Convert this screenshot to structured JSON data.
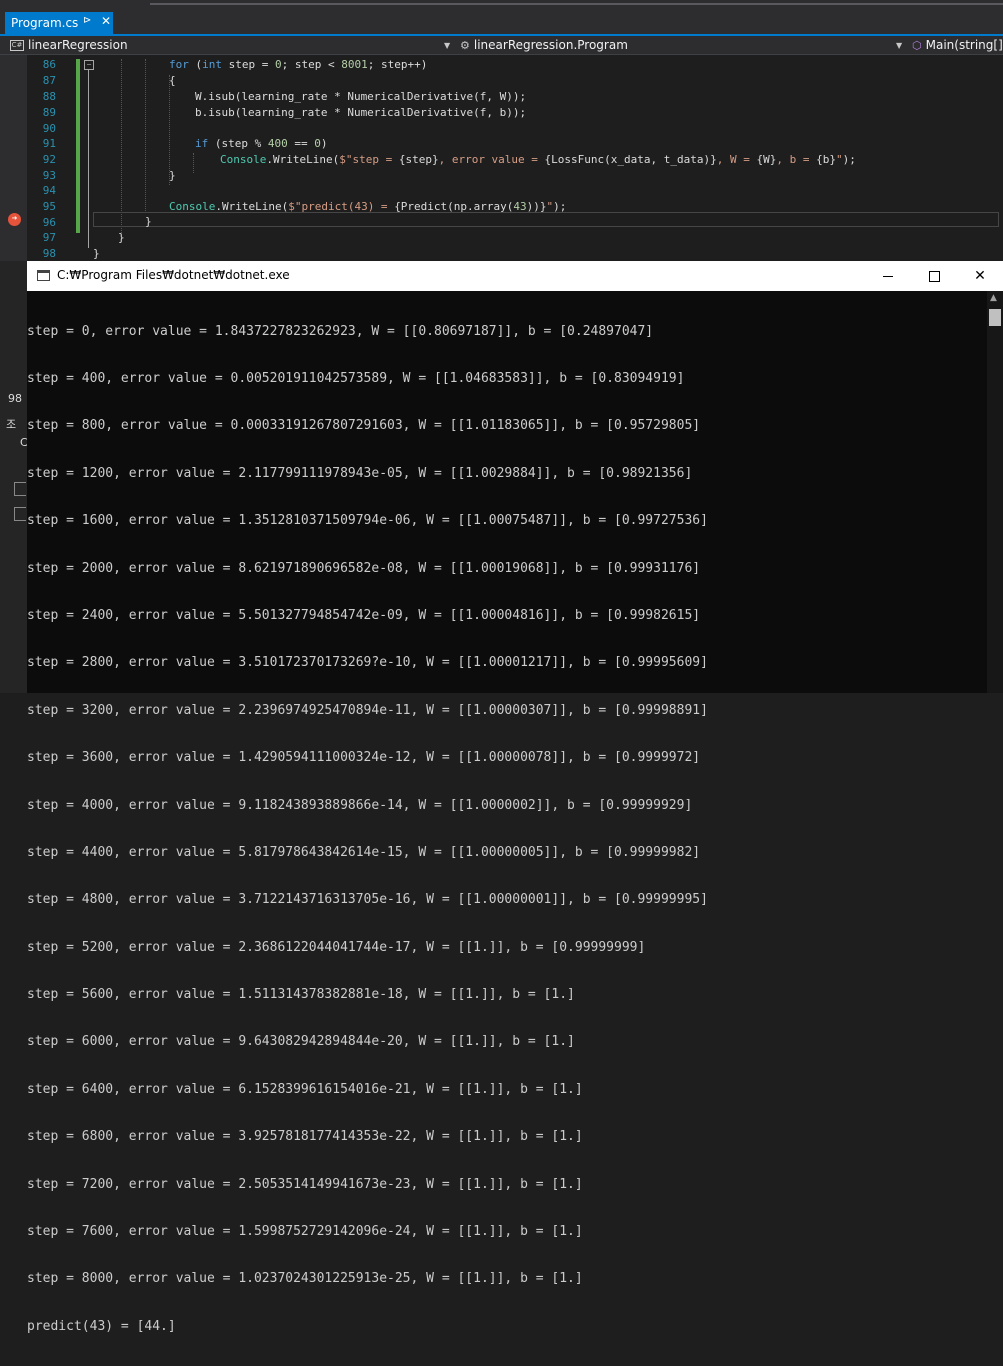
{
  "tab": {
    "title": "Program.cs",
    "pin": "⊳",
    "close": "✕"
  },
  "nav": {
    "project": "linearRegression",
    "class": "linearRegression.Program",
    "member": "Main(string[]"
  },
  "editor": {
    "line_numbers": [
      "86",
      "87",
      "88",
      "89",
      "90",
      "91",
      "92",
      "93",
      "94",
      "95",
      "96",
      "97",
      "98"
    ]
  },
  "side_panel": {
    "labels": [
      "98",
      "조",
      "C"
    ]
  },
  "console": {
    "title": "C:₩Program Files₩dotnet₩dotnet.exe",
    "lines": [
      "step = 0, error value = 1.8437227823262923, W = [[0.80697187]], b = [0.24897047]",
      "step = 400, error value = 0.005201911042573589, W = [[1.04683583]], b = [0.83094919]",
      "step = 800, error value = 0.0003319126780729160З, W = [[1.01183065]], b = [0.95729805]",
      "step = 1200, error value = 2.117799111978943e-05, W = [[1.0029884]], b = [0.98921356]",
      "step = 1600, error value = 1.3512810371509794e-06, W = [[1.00075487]], b = [0.99727536]",
      "step = 2000, error value = 8.621971890696582e-08, W = [[1.00019068]], b = [0.99931176]",
      "step = 2400, error value = 5.501327794854742e-09, W = [[1.00004816]], b = [0.99982615]",
      "step = 2800, error value = 3.510172370173269?e-10, W = [[1.00001217]], b = [0.99995609]",
      "step = 3200, error value = 2.2396974925470894e-11, W = [[1.00000307]], b = [0.99998891]",
      "step = 3600, error value = 1.4290594111000324e-12, W = [[1.00000078]], b = [0.9999972]",
      "step = 4000, error value = 9.118243893889866e-14, W = [[1.0000002]], b = [0.99999929]",
      "step = 4400, error value = 5.817978643842614e-15, W = [[1.00000005]], b = [0.99999982]",
      "step = 4800, error value = 3.712214371631370​5e-16, W = [[1.00000001]], b = [0.99999995]",
      "step = 5200, error value = 2.368612204404174​4e-17, W = [[1.]], b = [0.99999999]",
      "step = 5600, error value = 1.511314378382881e-18, W = [[1.]], b = [1.]",
      "step = 6000, error value = 9.643082942894844e-20, W = [[1.]], b = [1.]",
      "step = 6400, error value = 6.1528399616154016e-21, W = [[1.]], b = [1.]",
      "step = 6800, error value = 3.925781817741435​3e-22, W = [[1.]], b = [1.]",
      "step = 7200, error value = 2.505351414994167​3e-23, W = [[1.]], b = [1.]",
      "step = 7600, error value = 1.599875272914209​6e-24, W = [[1.]], b = [1.]",
      "step = 8000, error value = 1.0237024301225913e-25, W = [[1.]], b = [1.]",
      "predict(43) = [44.]"
    ]
  },
  "colors": {
    "accent": "#007acc",
    "console_bg": "#0c0c0c",
    "editor_bg": "#1e1e1e"
  }
}
